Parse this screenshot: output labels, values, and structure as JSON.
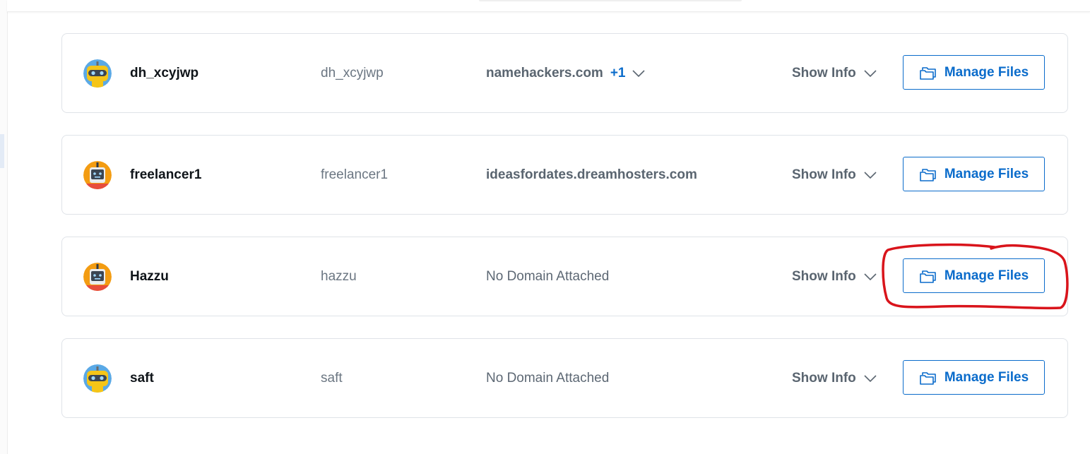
{
  "accent_color": "#0b6ccb",
  "annotation_color": "#d9141b",
  "users": [
    {
      "name": "dh_xcyjwp",
      "username": "dh_xcyjwp",
      "domain": "namehackers.com",
      "domain_extra": "+1",
      "show_info_label": "Show Info",
      "manage_label": "Manage Files",
      "avatar_icon": "yellow-visor-robot-icon"
    },
    {
      "name": "freelancer1",
      "username": "freelancer1",
      "domain": "ideasfordates.dreamhosters.com",
      "show_info_label": "Show Info",
      "manage_label": "Manage Files",
      "avatar_icon": "orange-robot-icon"
    },
    {
      "name": "Hazzu",
      "username": "hazzu",
      "domain": "No Domain Attached",
      "show_info_label": "Show Info",
      "manage_label": "Manage Files",
      "avatar_icon": "orange-robot-icon"
    },
    {
      "name": "saft",
      "username": "saft",
      "domain": "No Domain Attached",
      "show_info_label": "Show Info",
      "manage_label": "Manage Files",
      "avatar_icon": "yellow-visor-robot-icon"
    }
  ]
}
